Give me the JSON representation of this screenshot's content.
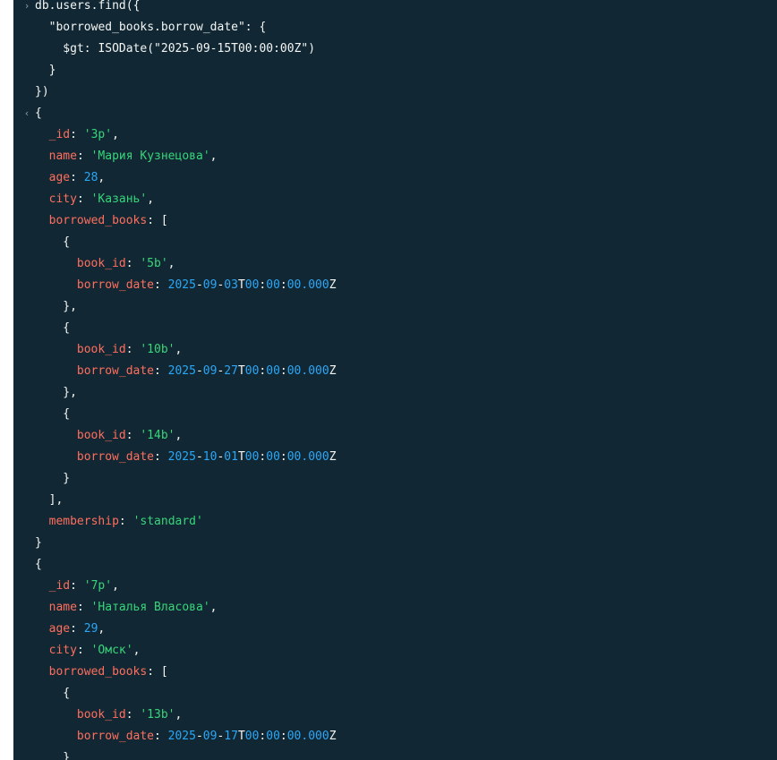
{
  "shell": {
    "input_prompt": "›",
    "output_prompt": "‹",
    "query_lines": [
      "db.users.find({",
      "  \"borrowed_books.borrow_date\": {",
      "    $gt: ISODate(\"2025-09-15T00:00:00Z\")",
      "  }",
      "})"
    ]
  },
  "results": [
    {
      "_id": "'3p'",
      "name": "'Мария Кузнецова'",
      "age": "28",
      "city": "'Казань'",
      "borrowed_books": [
        {
          "book_id": "'5b'",
          "borrow_date": {
            "y": "2025",
            "m": "09",
            "d": "03",
            "hh": "00",
            "mm": "00",
            "ss": "00.000"
          }
        },
        {
          "book_id": "'10b'",
          "borrow_date": {
            "y": "2025",
            "m": "09",
            "d": "27",
            "hh": "00",
            "mm": "00",
            "ss": "00.000"
          }
        },
        {
          "book_id": "'14b'",
          "borrow_date": {
            "y": "2025",
            "m": "10",
            "d": "01",
            "hh": "00",
            "mm": "00",
            "ss": "00.000"
          }
        }
      ],
      "membership": "'standard'"
    },
    {
      "_id": "'7p'",
      "name": "'Наталья Власова'",
      "age": "29",
      "city": "'Омск'",
      "borrowed_books": [
        {
          "book_id": "'13b'",
          "borrow_date": {
            "y": "2025",
            "m": "09",
            "d": "17",
            "hh": "00",
            "mm": "00",
            "ss": "00.000"
          }
        }
      ]
    }
  ],
  "colors": {
    "background": "#112733",
    "text": "#f3f6f5",
    "key": "#ff6f5e",
    "string": "#37d67a",
    "number": "#2aa7f7",
    "prompt": "#8a9ea8"
  }
}
